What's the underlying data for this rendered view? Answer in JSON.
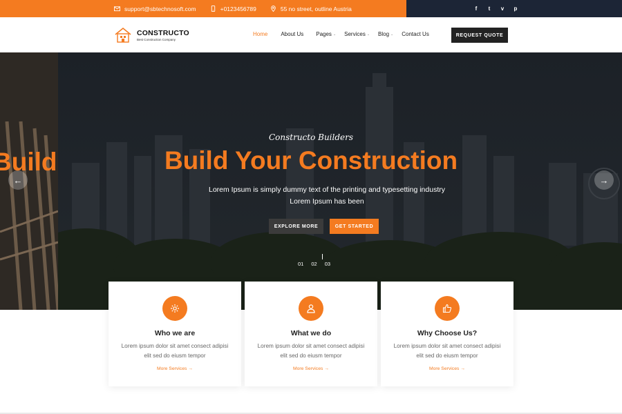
{
  "topbar": {
    "email": "support@sbtechnosoft.com",
    "phone": "+0123456789",
    "address": "55 no street, outline Austria",
    "socials": [
      "f",
      "t",
      "v",
      "p"
    ],
    "icons": [
      "mail-icon",
      "phone-icon",
      "location-icon",
      "facebook-icon",
      "twitter-icon",
      "vimeo-icon",
      "pinterest-icon"
    ]
  },
  "header": {
    "logo_name": "CONSTRUCTO",
    "logo_tagline": "Best Construction Company",
    "nav": [
      {
        "label": "Home",
        "caret": ""
      },
      {
        "label": "About Us",
        "caret": ""
      },
      {
        "label": "Pages",
        "caret": "⌄"
      },
      {
        "label": "Services",
        "caret": "⌄"
      },
      {
        "label": "Blog",
        "caret": "⌄"
      },
      {
        "label": "Contact Us",
        "caret": ""
      }
    ],
    "quote_button": "REQUEST QUOTE"
  },
  "hero": {
    "prev_slide_title": "Build Y",
    "subtitle": "Constructo Builders",
    "title": "Build Your Construction",
    "description": "Lorem Ipsum is simply dummy text of the printing and typesetting industry Lorem Ipsum has been",
    "explore_button": "EXPLORE MORE",
    "start_button": "GET STARTED",
    "pager": [
      "01",
      "02",
      "03"
    ],
    "prev_arrow": "←",
    "next_arrow": "→"
  },
  "features": [
    {
      "title": "Who we are",
      "text": "Lorem ipsum dolor sit amet consect adipisi elit sed do eiusm tempor",
      "link": "More Services →",
      "icon": "gear-icon"
    },
    {
      "title": "What we do",
      "text": "Lorem ipsum dolor sit amet consect adipisi elit sed do eiusm tempor",
      "link": "More Services →",
      "icon": "user-icon"
    },
    {
      "title": "Why Choose Us?",
      "text": "Lorem ipsum dolor sit amet consect adipisi elit sed do eiusm tempor",
      "link": "More Services →",
      "icon": "thumbs-up-icon"
    }
  ],
  "colors": {
    "accent": "#f47b20",
    "dark": "#1c2536"
  }
}
